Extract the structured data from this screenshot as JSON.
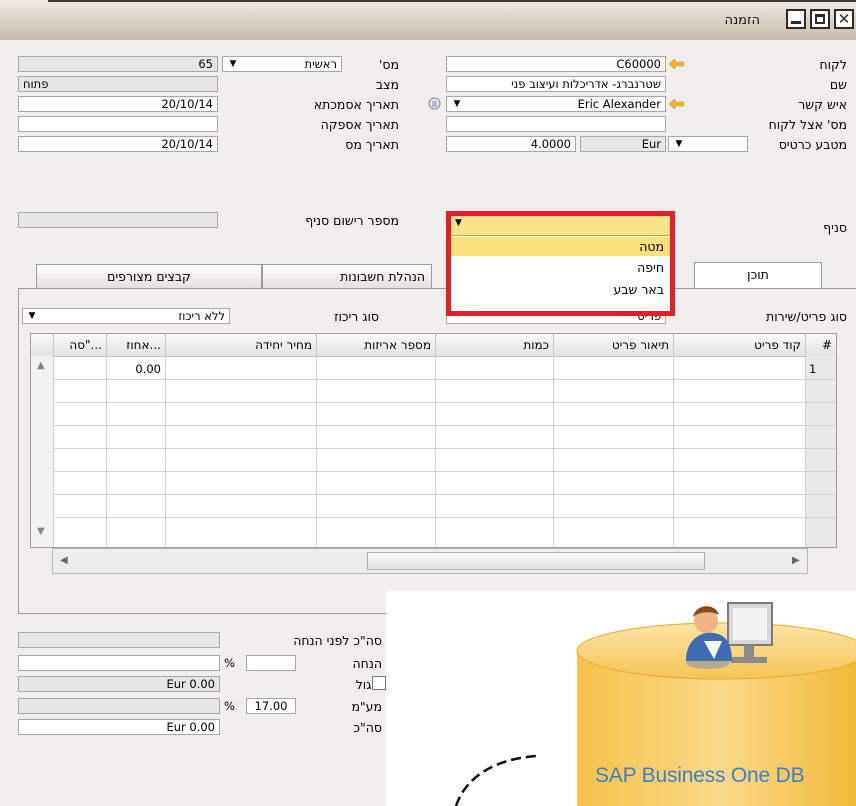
{
  "window": {
    "title": "הזמנה"
  },
  "header": {
    "customer": {
      "label": "לקוח",
      "value": "C60000"
    },
    "name": {
      "label": "שם",
      "value": "שטרנברג- אדריכלות ועיצוב פני"
    },
    "contact_person": {
      "label": "איש קשר",
      "value": "Eric Alexander"
    },
    "customer_ref": {
      "label": "מס' אצל לקוח",
      "value": ""
    },
    "currency": {
      "label": "מטבע כרטיס",
      "code": "Eur",
      "rate": "4.0000"
    },
    "number": {
      "label": "מס'",
      "series": "ראשית",
      "value": "65"
    },
    "status": {
      "label": "מצב",
      "value": "פתוח"
    },
    "posting_date": {
      "label": "תאריך אסמכתא",
      "value": "20/10/14"
    },
    "delivery_date": {
      "label": "תאריך אספקה",
      "value": ""
    },
    "document_date": {
      "label": "תאריך מס",
      "value": "20/10/14"
    },
    "branch": {
      "label": "סניף"
    },
    "branch_reg_no": {
      "label": "מספר רישום סניף",
      "value": ""
    }
  },
  "branch_dropdown": {
    "options": [
      "מטה",
      "חיפה",
      "באר שבע"
    ],
    "selected": "מטה"
  },
  "tabs": [
    {
      "label": "תוכן",
      "active": true
    },
    {
      "label": "הנהלת חשבונות",
      "active": false
    },
    {
      "label": "קבצים מצורפים",
      "active": false
    }
  ],
  "content": {
    "item_type_label": "סוג פריט/שירות",
    "item_type_value": "פריט",
    "summary_type_label": "סוג ריכוז",
    "summary_type_value": "ללא ריכוז"
  },
  "table": {
    "columns": [
      "#",
      "קוד פריט",
      "תיאור פריט",
      "כמות",
      "מספר אריזות",
      "מחיר יחידה",
      "אחוז...",
      "סה\"..."
    ],
    "rows": [
      {
        "num": "1",
        "discount": "0.00"
      }
    ]
  },
  "footer": {
    "total_before_discount": {
      "label": "סה\"כ לפני הנחה",
      "value": ""
    },
    "discount": {
      "label": "הנחה",
      "pct": "",
      "unit": "%",
      "value": ""
    },
    "rounding": {
      "label": "עיגול",
      "value": "Eur 0.00"
    },
    "tax": {
      "label": "מע\"מ",
      "pct": "17.00",
      "unit": "%",
      "value": ""
    },
    "total": {
      "label": "סה\"כ",
      "value": "Eur 0.00"
    }
  },
  "overlay": {
    "db_label": "SAP Business One DB"
  },
  "colors": {
    "highlight_red": "#e21f2b",
    "selected_yellow": "#fbe07e",
    "link_arrow": "#f2b233",
    "sap_blue": "#3d7fc6"
  }
}
